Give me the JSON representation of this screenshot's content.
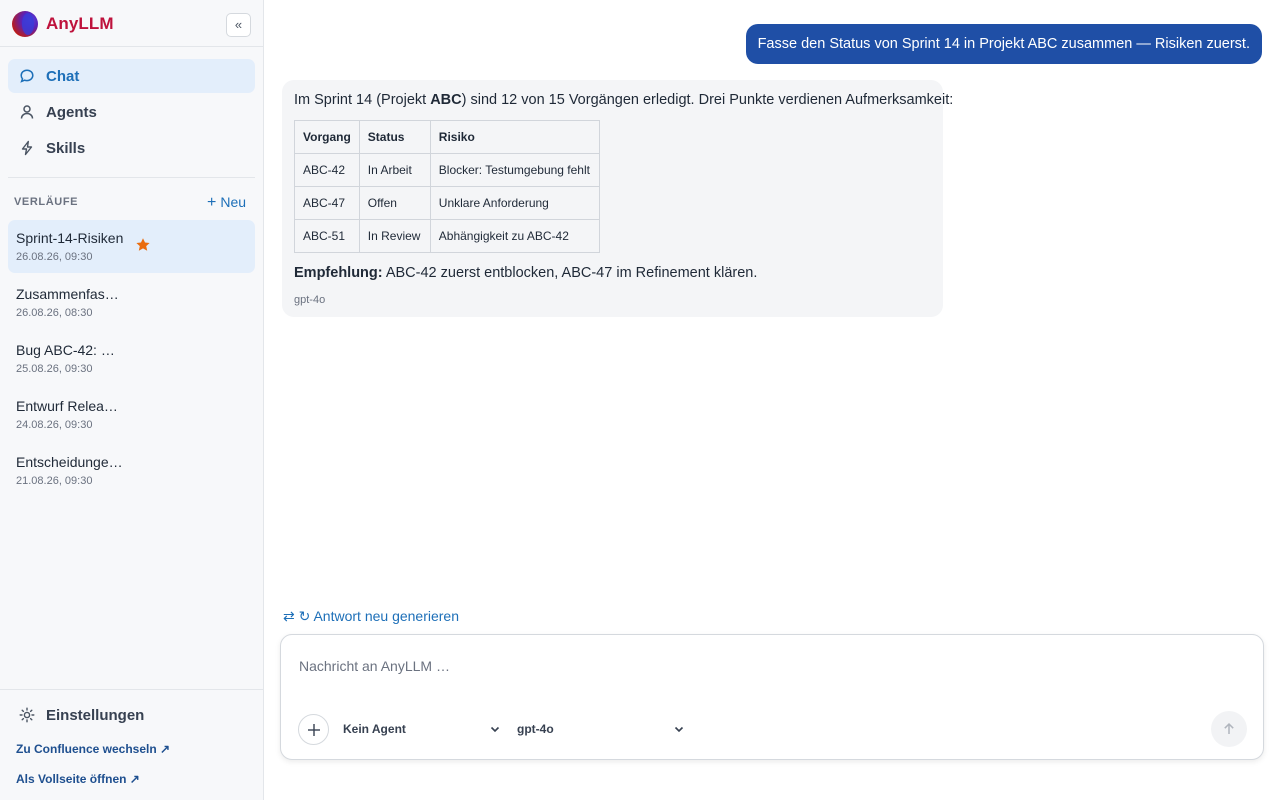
{
  "app": {
    "name": "AnyLLM",
    "collapse_label": "«"
  },
  "nav": [
    {
      "label": "Chat",
      "icon": "chat-bubble-icon",
      "active": true
    },
    {
      "label": "Agents",
      "icon": "user-icon",
      "active": false
    },
    {
      "label": "Skills",
      "icon": "lightning-icon",
      "active": false
    }
  ],
  "history": {
    "title": "VERLÄUFE",
    "new_label": "Neu",
    "items": [
      {
        "title": "Sprint-14-Risiken",
        "date": "26.08.26, 09:30",
        "starred": true,
        "active": true
      },
      {
        "title": "Zusammenfas…",
        "date": "26.08.26, 08:30",
        "starred": false,
        "active": false
      },
      {
        "title": "Bug ABC-42: …",
        "date": "25.08.26, 09:30",
        "starred": false,
        "active": false
      },
      {
        "title": "Entwurf Relea…",
        "date": "24.08.26, 09:30",
        "starred": false,
        "active": false
      },
      {
        "title": "Entscheidunge…",
        "date": "21.08.26, 09:30",
        "starred": false,
        "active": false
      }
    ]
  },
  "footer": {
    "settings_label": "Einstellungen",
    "confluence_link": "Zu Confluence wechseln ↗",
    "fullpage_link": "Als Vollseite öffnen ↗"
  },
  "conversation": {
    "user_message": "Fasse den Status von Sprint 14 in Projekt ABC zusammen — Risiken zuerst.",
    "bot": {
      "intro_a": "Im Sprint 14 (Projekt ",
      "intro_bold": "ABC",
      "intro_b": ") sind 12 von 15 Vorgängen erledigt. Drei Punkte verdienen Aufmerksamkeit:",
      "table": {
        "headers": [
          "Vorgang",
          "Status",
          "Risiko"
        ],
        "rows": [
          [
            "ABC-42",
            "In Arbeit",
            "Blocker: Testumgebung fehlt"
          ],
          [
            "ABC-47",
            "Offen",
            "Unklare Anforderung"
          ],
          [
            "ABC-51",
            "In Review",
            "Abhängigkeit zu ABC-42"
          ]
        ]
      },
      "recommendation_label": "Empfehlung:",
      "recommendation_text": " ABC-42 zuerst entblocken, ABC-47 im Refinement klären.",
      "model": "gpt-4o"
    }
  },
  "regenerate_label": "⇄ ↻ Antwort neu generieren",
  "composer": {
    "placeholder": "Nachricht an AnyLLM …",
    "value": "",
    "agent_selected": "Kein Agent",
    "model_selected": "gpt-4o"
  },
  "colors": {
    "brand": "#be123c",
    "accent": "#1d6fb8",
    "user_bubble": "#1f4fa6",
    "star": "#ea6c0e"
  }
}
